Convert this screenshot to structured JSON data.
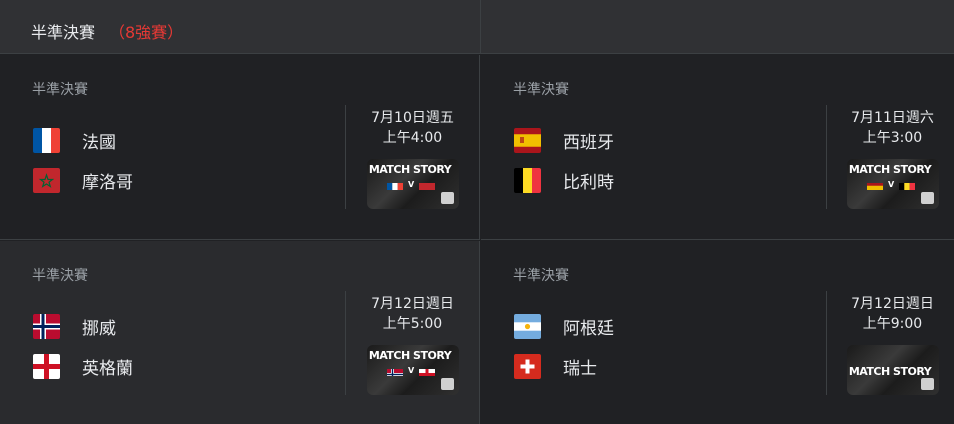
{
  "header": {
    "title": "半準決賽",
    "subtitle": "（8強賽）"
  },
  "matches": [
    {
      "stage": "半準決賽",
      "date": "7月10日週五",
      "time": "上午4:00",
      "home": {
        "name": "法國",
        "flag": "france-flag"
      },
      "away": {
        "name": "摩洛哥",
        "flag": "morocco-flag"
      },
      "thumbnail": "MATCH STORY",
      "vs": "V"
    },
    {
      "stage": "半準決賽",
      "date": "7月11日週六",
      "time": "上午3:00",
      "home": {
        "name": "西班牙",
        "flag": "spain-flag"
      },
      "away": {
        "name": "比利時",
        "flag": "belgium-flag"
      },
      "thumbnail": "MATCH STORY",
      "vs": "V"
    },
    {
      "stage": "半準決賽",
      "date": "7月12日週日",
      "time": "上午5:00",
      "home": {
        "name": "挪威",
        "flag": "norway-flag"
      },
      "away": {
        "name": "英格蘭",
        "flag": "england-flag"
      },
      "thumbnail": "MATCH STORY",
      "vs": "V"
    },
    {
      "stage": "半準決賽",
      "date": "7月12日週日",
      "time": "上午9:00",
      "home": {
        "name": "阿根廷",
        "flag": "argentina-flag"
      },
      "away": {
        "name": "瑞士",
        "flag": "switzerland-flag"
      },
      "thumbnail": "MATCH STORY"
    }
  ],
  "colors": {
    "accent": "#e53935",
    "background": "#202124",
    "header": "#303134"
  }
}
